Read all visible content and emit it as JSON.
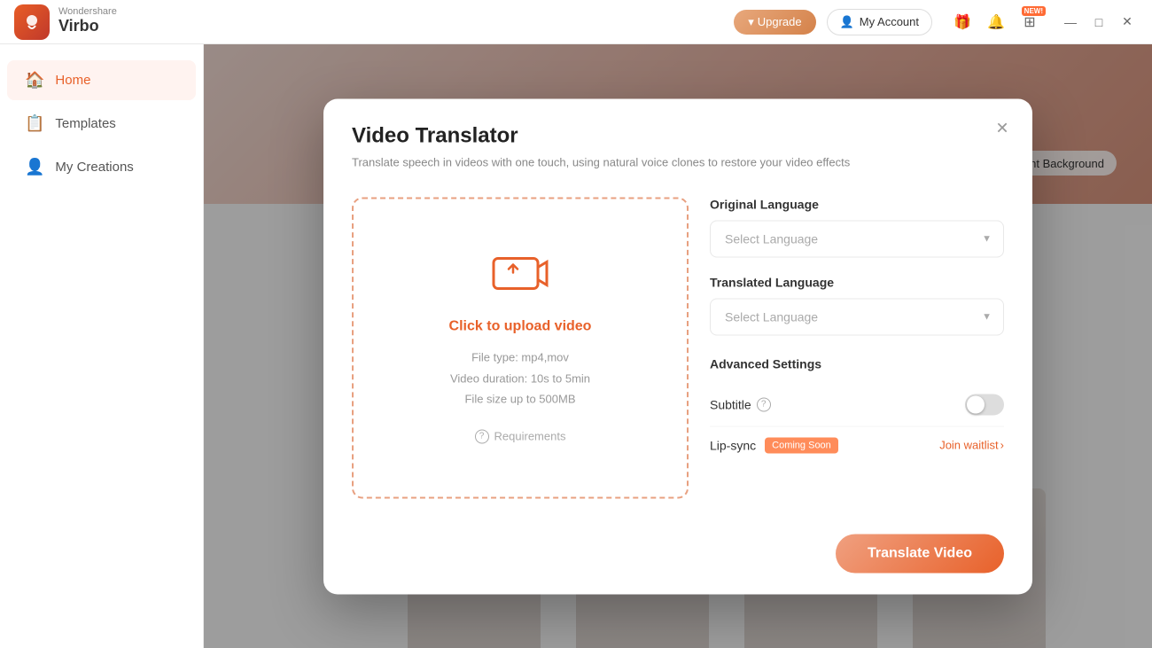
{
  "app": {
    "brand": "Wondershare",
    "product": "Virbo",
    "logo_emoji": "🎬"
  },
  "titlebar": {
    "upgrade_label": "Upgrade",
    "my_account_label": "My Account",
    "new_badge": "NEW!",
    "icon_gift": "🎁",
    "icon_bell": "🔔",
    "icon_apps": "⊞",
    "icon_minimize": "—",
    "icon_maximize": "□",
    "icon_close": "✕"
  },
  "sidebar": {
    "items": [
      {
        "id": "home",
        "label": "Home",
        "icon": "🏠",
        "active": true
      },
      {
        "id": "templates",
        "label": "Templates",
        "icon": "📋",
        "active": false
      },
      {
        "id": "my-creations",
        "label": "My Creations",
        "icon": "👤",
        "active": false
      }
    ]
  },
  "modal": {
    "title": "Video Translator",
    "subtitle": "Translate speech in videos with one touch, using natural voice clones to restore your video effects",
    "close_label": "✕",
    "upload": {
      "click_label": "Click to upload video",
      "file_type": "File type: mp4,mov",
      "duration": "Video duration: 10s to 5min",
      "file_size": "File size up to  500MB",
      "requirements_label": "Requirements"
    },
    "settings": {
      "original_language_label": "Original Language",
      "original_language_placeholder": "Select Language",
      "translated_language_label": "Translated Language",
      "translated_language_placeholder": "Select Language",
      "advanced_label": "Advanced Settings",
      "subtitle_label": "Subtitle",
      "lip_sync_label": "Lip-sync",
      "coming_soon_label": "Coming Soon",
      "join_waitlist_label": "Join waitlist",
      "chevron": "›"
    },
    "footer": {
      "translate_btn": "Translate Video"
    }
  },
  "background": {
    "transparent_bg_label": "ransparent Background"
  }
}
